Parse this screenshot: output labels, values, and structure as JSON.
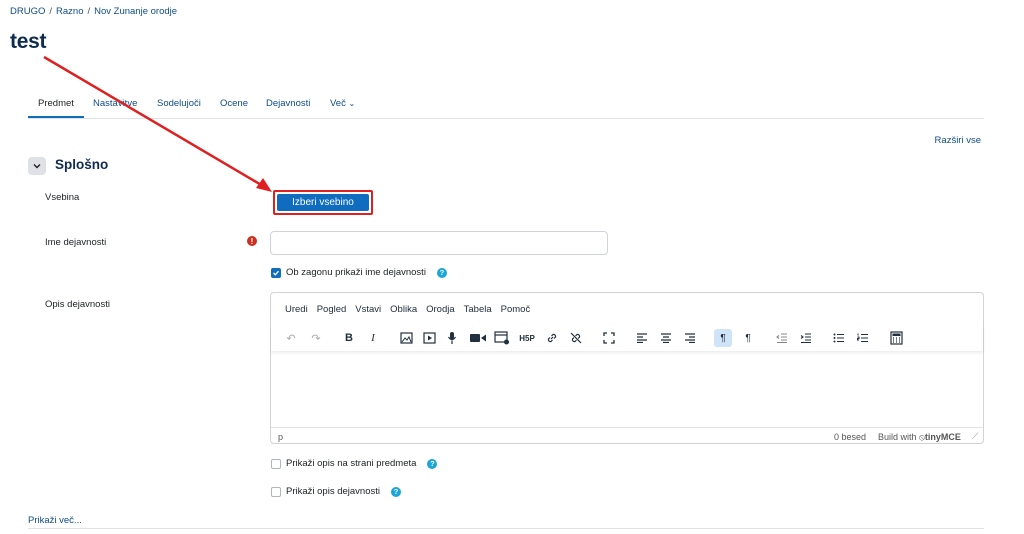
{
  "breadcrumb": {
    "items": [
      "DRUGO",
      "Razno",
      "Nov Zunanje orodje"
    ]
  },
  "page": {
    "title": "test"
  },
  "tabs": [
    "Predmet",
    "Nastavitve",
    "Sodelujoči",
    "Ocene",
    "Dejavnosti",
    "Več"
  ],
  "expand_all": "Razširi vse",
  "section": {
    "title": "Splošno"
  },
  "fields": {
    "content_label": "Vsebina",
    "content_button": "Izberi vsebino",
    "name_label": "Ime dejavnosti",
    "name_value": "",
    "show_name_checkbox": "Ob zagonu prikaži ime dejavnosti",
    "description_label": "Opis dejavnosti",
    "show_desc_course": "Prikaži opis na strani predmeta",
    "show_desc_activity": "Prikaži opis dejavnosti"
  },
  "editor": {
    "menu": [
      "Uredi",
      "Pogled",
      "Vstavi",
      "Oblika",
      "Orodja",
      "Tabela",
      "Pomoč"
    ],
    "status_path": "p",
    "word_count": "0 besed",
    "build_with": "Build with",
    "brand": "tinyMCE"
  },
  "show_more": "Prikaži več...",
  "colors": {
    "accent": "#0f6cbf",
    "annotation": "#e02020"
  }
}
